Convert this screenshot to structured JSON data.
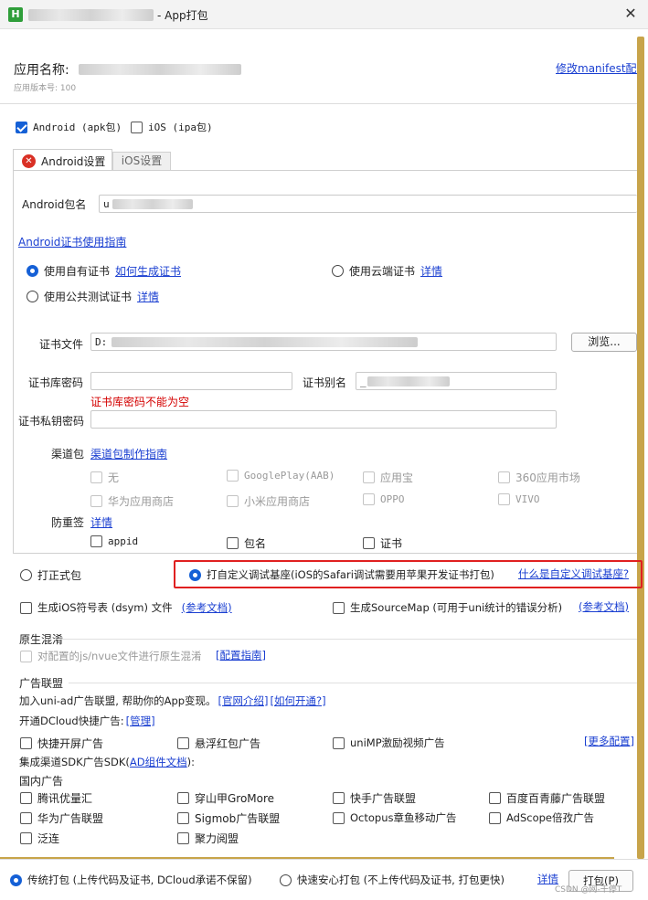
{
  "window": {
    "title": "- App打包",
    "close_glyph": "✕",
    "logo_letter": "H"
  },
  "header": {
    "app_name_label": "应用名称:",
    "app_version": "应用版本号: 100",
    "manifest_link": "修改manifest配置"
  },
  "platforms": {
    "android_label": "Android (apk包)",
    "ios_label": "iOS (ipa包)"
  },
  "tabs": [
    {
      "label": "Android设置",
      "error_glyph": "✕"
    },
    {
      "label": "iOS设置"
    }
  ],
  "android": {
    "package_label": "Android包名",
    "package_value_prefix": "u",
    "cert_guide_link": "Android证书使用指南",
    "own_cert_label": "使用自有证书",
    "how_to_generate_link": "如何生成证书",
    "cloud_cert_label": "使用云端证书",
    "cloud_detail_link": "详情",
    "public_test_cert_label": "使用公共测试证书",
    "public_detail_link": "详情",
    "cert_file_label": "证书文件",
    "cert_file_prefix": "D:",
    "browse_button": "浏览...",
    "keystore_pwd_label": "证书库密码",
    "alias_label": "证书别名",
    "alias_prefix": "_",
    "keystore_error": "证书库密码不能为空",
    "private_key_pwd_label": "证书私钥密码",
    "channel_label": "渠道包",
    "channel_guide_link": "渠道包制作指南",
    "channels": [
      "无",
      "GooglePlay(AAB)",
      "应用宝",
      "360应用市场",
      "华为应用商店",
      "小米应用商店",
      "OPPO",
      "VIVO"
    ],
    "anti_resign_label": "防重签",
    "anti_resign_detail_link": "详情",
    "anti_resign_options": [
      "appid",
      "包名",
      "证书"
    ]
  },
  "build_type": {
    "formal_label": "打正式包",
    "custom_base_label": "打自定义调试基座(iOS的Safari调试需要用苹果开发证书打包)",
    "what_is_custom_link": "什么是自定义调试基座?"
  },
  "options": {
    "dsym_label": "生成iOS符号表 (dsym) 文件",
    "dsym_doc_link": "(参考文档)",
    "sourcemap_label": "生成SourceMap (可用于uni统计的错误分析)",
    "sourcemap_doc_link": "(参考文档)"
  },
  "obfuscation": {
    "title": "原生混淆",
    "checkbox_label": "对配置的js/nvue文件进行原生混淆",
    "guide_link": "[配置指南]"
  },
  "ads": {
    "title": "广告联盟",
    "intro_text": "加入uni-ad广告联盟, 帮助你的App变现。",
    "intro_link": "[官网介绍]",
    "how_to_join_link": "[如何开通?]",
    "dcloud_text": "开通DCloud快捷广告:",
    "manage_link": "[管理]",
    "quick_ads": [
      "快捷开屏广告",
      "悬浮红包广告",
      "uniMP激励视频广告"
    ],
    "more_config_link": "[更多配置]",
    "sdk_text_prefix": "集成渠道SDK广告SDK(",
    "sdk_doc_link": "AD组件文档",
    "sdk_text_suffix": "):",
    "domestic_label": "国内广告",
    "domestic_ads": [
      "腾讯优量汇",
      "穿山甲GroMore",
      "快手广告联盟",
      "百度百青藤广告联盟",
      "华为广告联盟",
      "Sigmob广告联盟",
      "Octopus章鱼移动广告",
      "AdScope倍孜广告",
      "泛连",
      "聚力阅盟"
    ]
  },
  "footer": {
    "traditional_label": "传统打包 (上传代码及证书, DCloud承诺不保留)",
    "fast_label": "快速安心打包 (不上传代码及证书, 打包更快)",
    "detail_link": "详情",
    "pack_button": "打包(P)",
    "watermark": "CSDN @网-干停T"
  },
  "colors": {
    "accent": "#1560d6",
    "link": "#1a3fd1",
    "error": "#d40000",
    "highlight_box": "#e02020",
    "scrollbar": "#c8a44a"
  }
}
